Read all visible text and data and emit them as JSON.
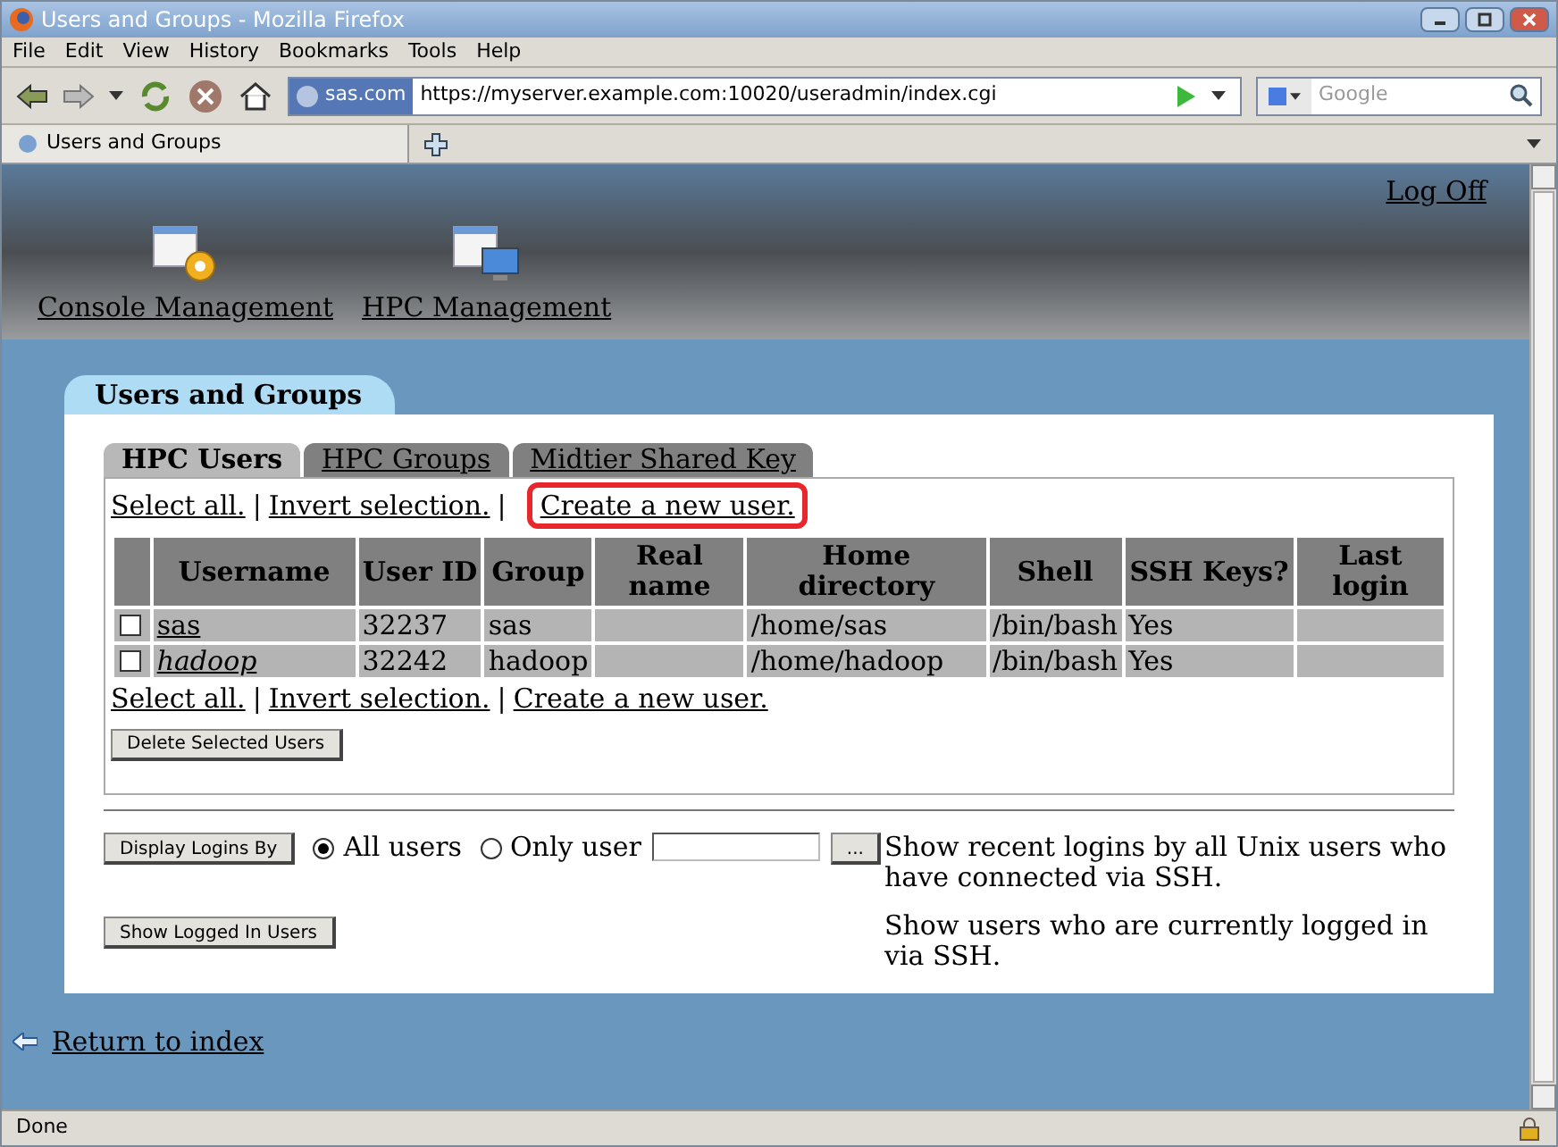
{
  "window": {
    "title": "Users and Groups - Mozilla Firefox"
  },
  "menu": [
    "File",
    "Edit",
    "View",
    "History",
    "Bookmarks",
    "Tools",
    "Help"
  ],
  "address": {
    "site": "sas.com",
    "url": "https://myserver.example.com:10020/useradmin/index.cgi"
  },
  "search": {
    "placeholder": "Google"
  },
  "browser_tabs": [
    {
      "label": "Users and Groups",
      "selected": true
    }
  ],
  "header": {
    "logoff": "Log Off",
    "modules": [
      {
        "label": "Console Management",
        "kind": "gear"
      },
      {
        "label": "HPC Management",
        "kind": "monitor"
      }
    ]
  },
  "panel": {
    "title": "Users and Groups",
    "tabs": [
      {
        "label": "HPC Users",
        "selected": true
      },
      {
        "label": "HPC Groups",
        "selected": false
      },
      {
        "label": "Midtier Shared Key",
        "selected": false
      }
    ],
    "top_links": [
      {
        "label": "Select all.",
        "highlighted": false
      },
      {
        "label": "Invert selection.",
        "highlighted": false
      },
      {
        "label": "Create a new user.",
        "highlighted": true
      }
    ],
    "table": {
      "columns": [
        "Username",
        "User ID",
        "Group",
        "Real name",
        "Home directory",
        "Shell",
        "SSH Keys?",
        "Last login"
      ],
      "rows": [
        {
          "checked": false,
          "italic": false,
          "cells": [
            "sas",
            "32237",
            "sas",
            "",
            "/home/sas",
            "/bin/bash",
            "Yes",
            ""
          ]
        },
        {
          "checked": false,
          "italic": true,
          "cells": [
            "hadoop",
            "32242",
            "hadoop",
            "",
            "/home/hadoop",
            "/bin/bash",
            "Yes",
            ""
          ]
        }
      ]
    },
    "bottom_links": [
      {
        "label": "Select all.",
        "highlighted": false
      },
      {
        "label": "Invert selection.",
        "highlighted": false
      },
      {
        "label": "Create a new user.",
        "highlighted": false
      }
    ],
    "separator": "|",
    "delete_button": "Delete Selected Users",
    "logins": {
      "button": "Display Logins By",
      "options": [
        {
          "label": "All users",
          "selected": true
        },
        {
          "label": "Only user",
          "selected": false
        }
      ],
      "browse": "...",
      "description": "Show recent logins by all Unix users who have connected via SSH."
    },
    "logged_in": {
      "button": "Show Logged In Users",
      "description": "Show users who are currently logged in via SSH."
    }
  },
  "return_link": "Return to index",
  "status_bar": "Done"
}
